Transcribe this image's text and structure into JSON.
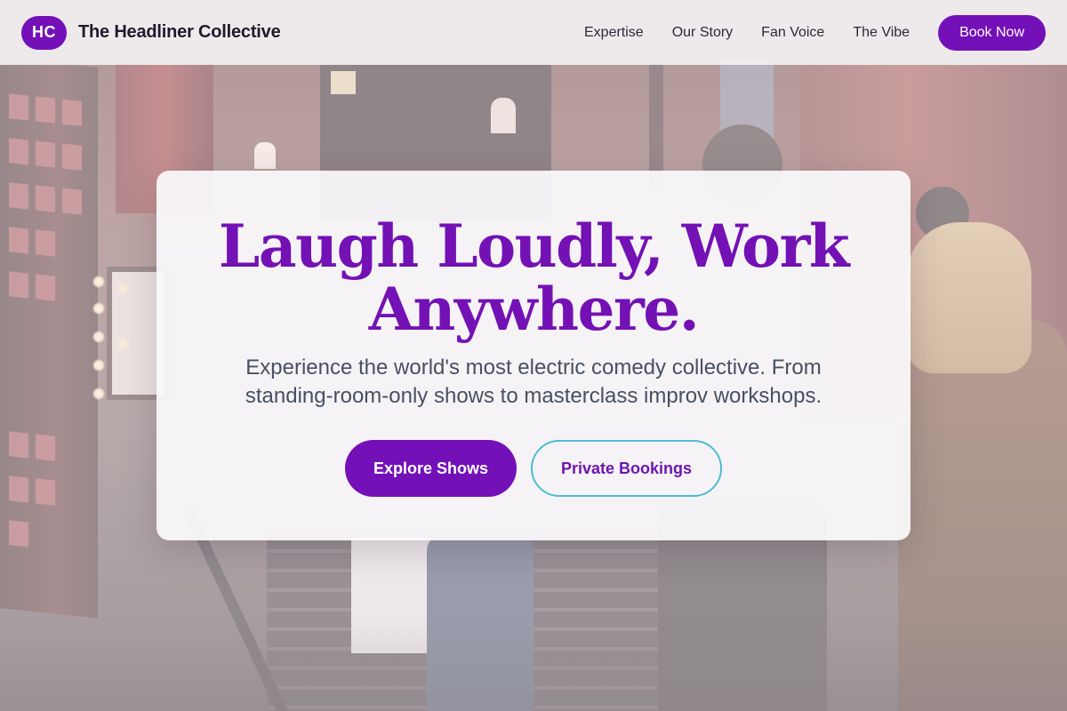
{
  "header": {
    "logo_initials": "HC",
    "brand_name": "The Headliner Collective",
    "nav": [
      "Expertise",
      "Our Story",
      "Fan Voice",
      "The Vibe"
    ],
    "cta_label": "Book Now"
  },
  "hero": {
    "headline": "Laugh Loudly, Work Anywhere.",
    "subheadline": "Experience the world's most electric comedy collective. From standing-room-only shows to masterclass improv workshops.",
    "primary_cta": "Explore Shows",
    "secondary_cta": "Private Bookings"
  },
  "colors": {
    "brand_purple": "#7310b8",
    "accent_cyan": "#4dbbd4",
    "body_text": "#475063",
    "header_bg": "#f1eff1"
  }
}
